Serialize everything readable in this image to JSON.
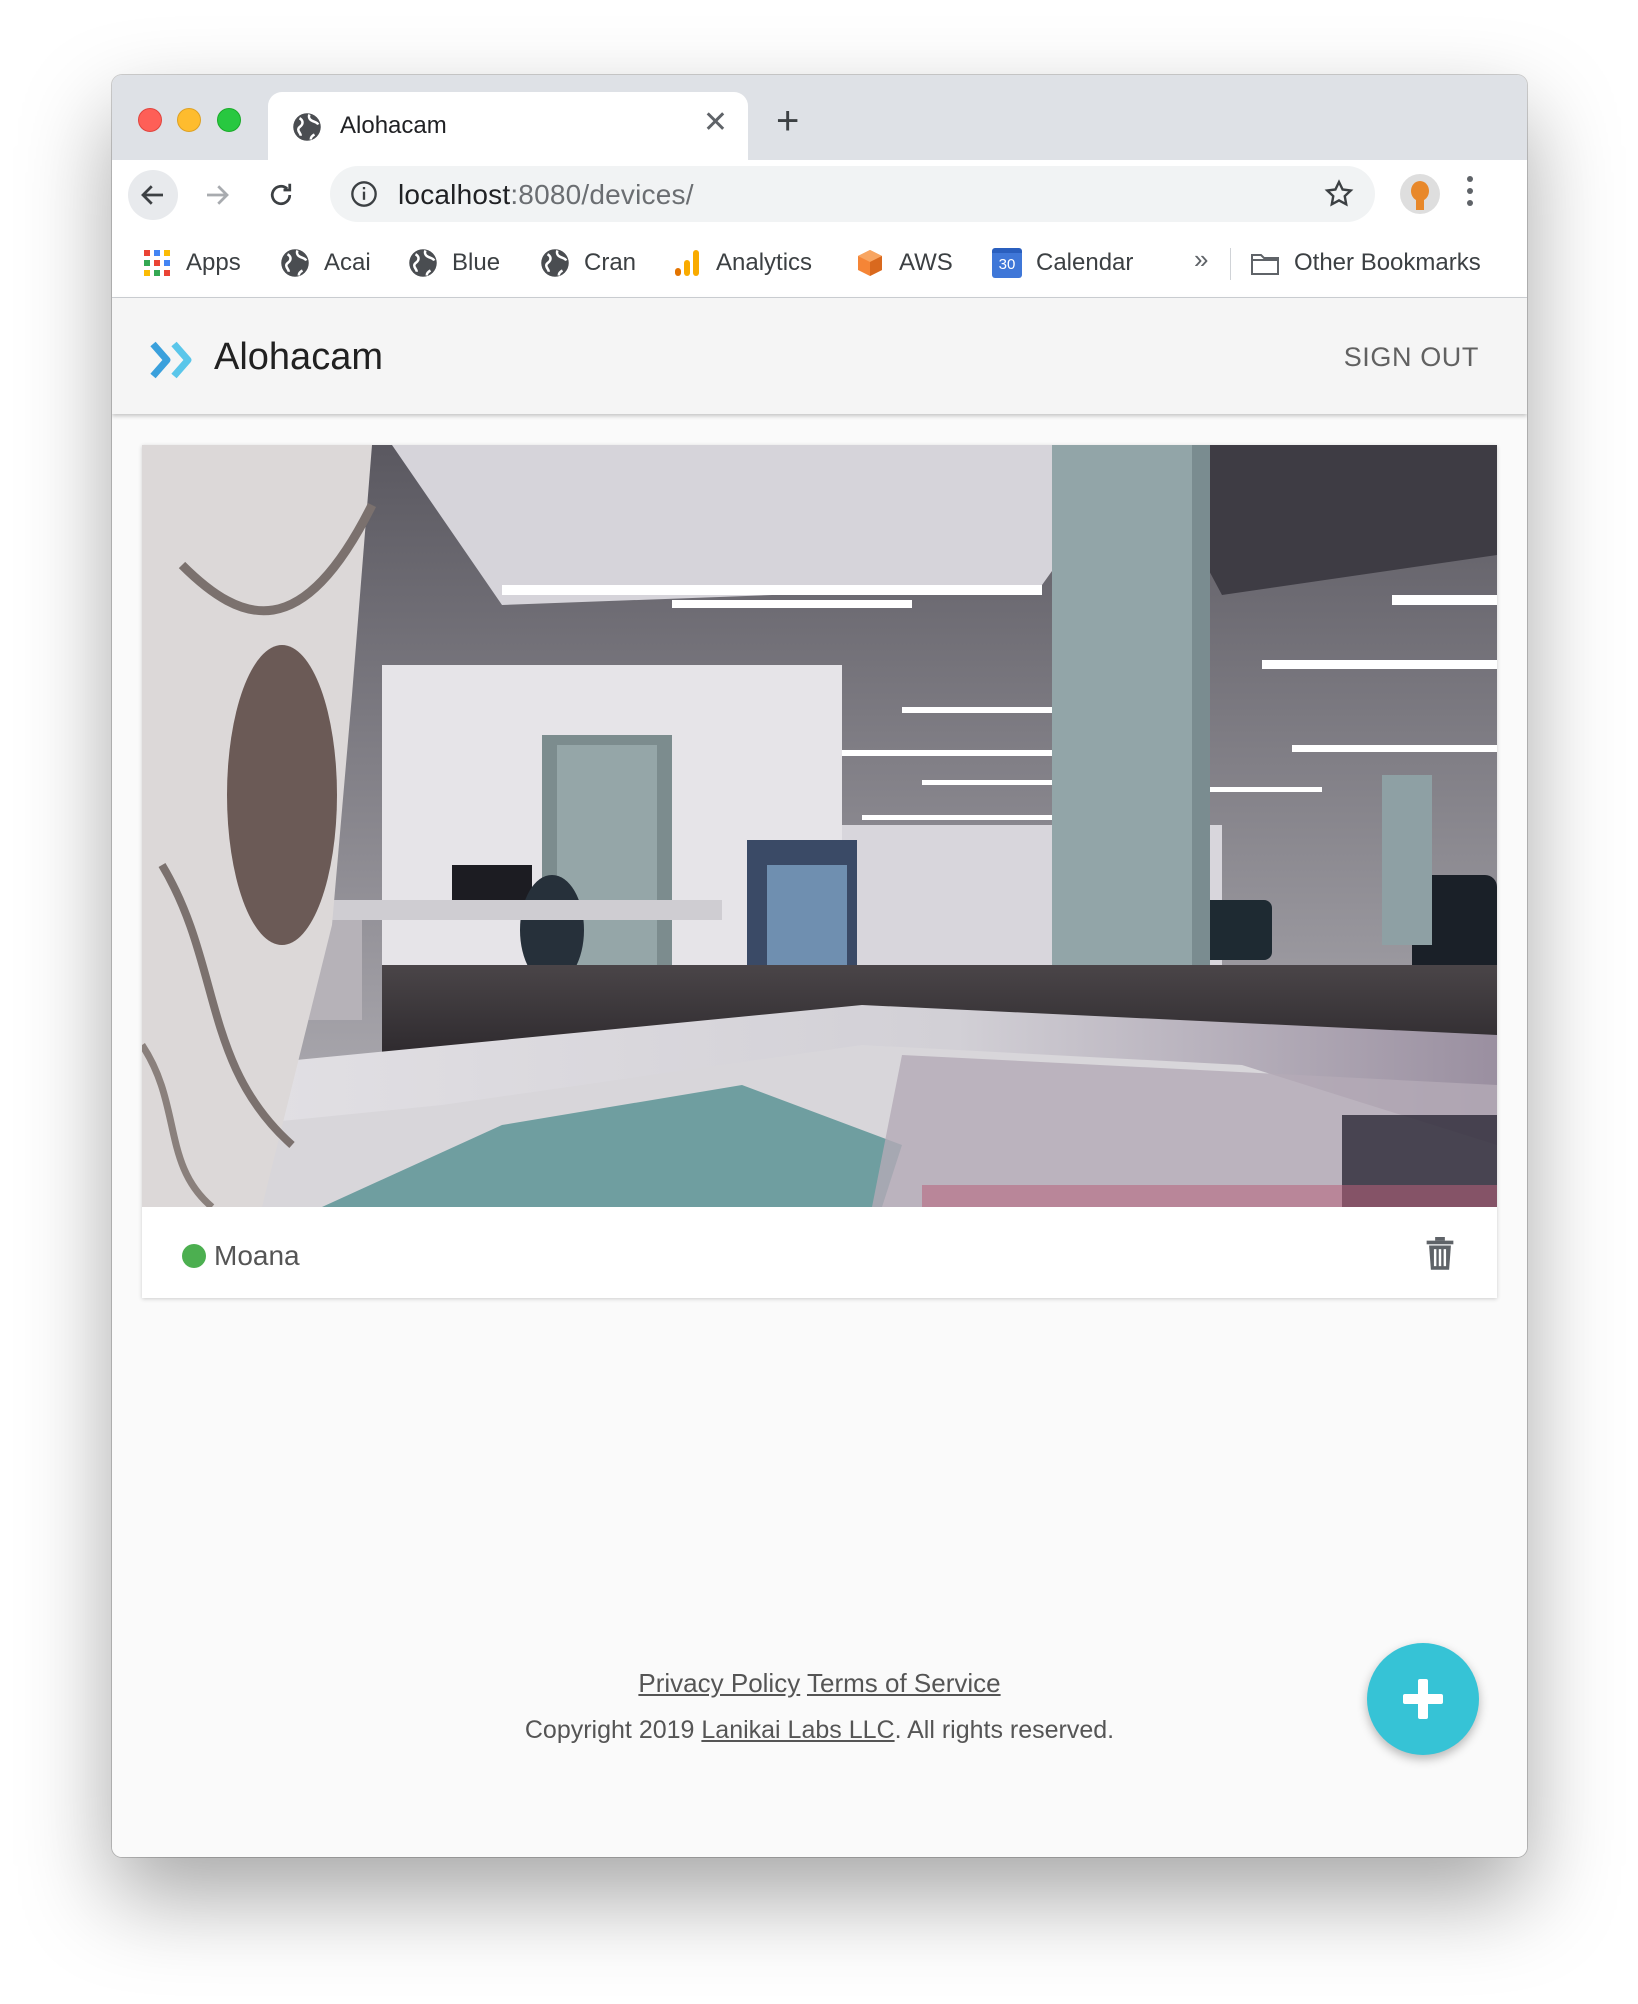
{
  "browser": {
    "tab_title": "Alohacam",
    "url_host": "localhost",
    "url_rest": ":8080/devices/",
    "bookmarks": [
      {
        "label": "Apps",
        "icon": "apps-grid-icon"
      },
      {
        "label": "Acai",
        "icon": "globe-icon"
      },
      {
        "label": "Blue",
        "icon": "globe-icon"
      },
      {
        "label": "Cran",
        "icon": "globe-icon"
      },
      {
        "label": "Analytics",
        "icon": "analytics-icon"
      },
      {
        "label": "AWS",
        "icon": "aws-icon"
      },
      {
        "label": "Calendar",
        "icon": "calendar-icon"
      }
    ],
    "bookmarks_overflow": "»",
    "other_bookmarks": "Other Bookmarks",
    "calendar_day": "30"
  },
  "app": {
    "brand": "Alohacam",
    "sign_out": "SIGN OUT",
    "accent_color": "#36c3d6"
  },
  "devices": [
    {
      "name": "Moana",
      "status": "online",
      "status_color": "#4caf50"
    }
  ],
  "footer": {
    "privacy": "Privacy Policy",
    "terms": "Terms of Service",
    "copyright_prefix": "Copyright 2019 ",
    "company": "Lanikai Labs LLC",
    "copyright_suffix": ". All rights reserved."
  }
}
